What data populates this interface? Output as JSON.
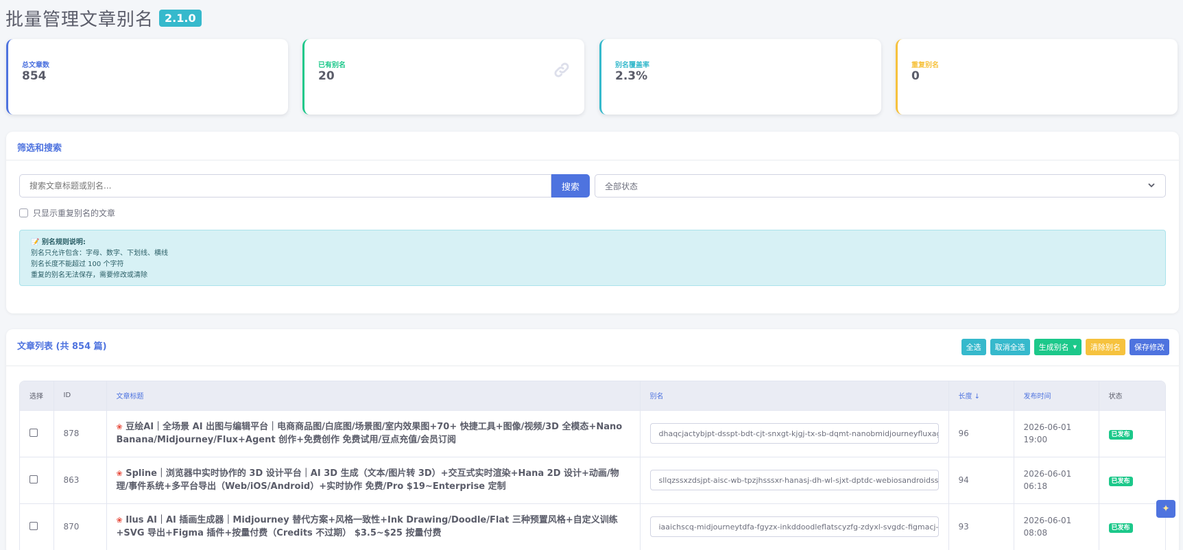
{
  "header": {
    "title": "批量管理文章别名",
    "version": "2.1.0"
  },
  "stats": [
    {
      "label": "总文章数",
      "value": "854",
      "color": "#4e73df",
      "icon": ""
    },
    {
      "label": "已有别名",
      "value": "20",
      "color": "#1cc88a",
      "icon": "link-icon"
    },
    {
      "label": "别名覆盖率",
      "value": "2.3%",
      "color": "#36b9cc",
      "icon": ""
    },
    {
      "label": "重复别名",
      "value": "0",
      "color": "#f6c23e",
      "icon": ""
    }
  ],
  "filter": {
    "heading": "筛选和搜索",
    "search_placeholder": "搜索文章标题或别名...",
    "search_button": "搜索",
    "status_select": "全部状态",
    "duplicate_only_label": "只显示重复别名的文章",
    "rules": {
      "title": "别名规则说明:",
      "lines": [
        "别名只允许包含：字母、数字、下划线、横线",
        "别名长度不能超过 100 个字符",
        "重复的别名无法保存，需要修改或清除"
      ]
    }
  },
  "list": {
    "heading": "文章列表 (共 854 篇)",
    "actions": {
      "select_all": "全选",
      "deselect_all": "取消全选",
      "generate": "生成别名",
      "clear": "清除别名",
      "save": "保存修改"
    },
    "columns": {
      "select": "选择",
      "id": "ID",
      "title": "文章标题",
      "alias": "别名",
      "length": "长度 ↓",
      "date": "发布时间",
      "status": "状态"
    },
    "rows": [
      {
        "id": "878",
        "title": "豆绘AI｜全场景 AI 出图与编辑平台｜电商商品图/白底图/场景图/室内效果图+70+ 快捷工具+图像/视频/3D 全模态+Nano Banana/Midjourney/Flux+Agent 创作+免费创作 免费试用/豆点充值/会员订阅",
        "alias": "dhaqcjactybjpt-dsspt-bdt-cjt-snxgt-kjgj-tx-sb-dqmt-nanobmidjourneyfluxagent",
        "length": "96",
        "date": "2026-06-01",
        "time": "19:00",
        "status": "已发布"
      },
      {
        "id": "863",
        "title": "Spline｜浏览器中实时协作的 3D 设计平台｜AI 3D 生成（文本/图片转 3D）+交互式实时渲染+Hana 2D 设计+动画/物理/事件系统+多平台导出（Web/iOS/Android）+实时协作 免费/Pro $19~Enterprise 定制",
        "alias": "sllqzssxzdsjpt-aisc-wb-tpzjhsssxr-hanasj-dh-wl-sjxt-dptdc-webiosandroidssxz",
        "length": "94",
        "date": "2026-06-01",
        "time": "06:18",
        "status": "已发布"
      },
      {
        "id": "870",
        "title": "Ilus AI｜AI 插画生成器｜Midjourney 替代方案+风格一致性+Ink Drawing/Doodle/Flat 三种预置风格+自定义训练+SVG 导出+Figma 插件+按量付费（Credits 不过期） $3.5~$25 按量付费",
        "alias": "iaaichscq-midjourneytdfa-fgyzx-inkddoodleflatscyzfg-zdyxl-svgdc-figmacj-alfl",
        "length": "93",
        "date": "2026-06-01",
        "time": "08:08",
        "status": "已发布"
      }
    ]
  }
}
